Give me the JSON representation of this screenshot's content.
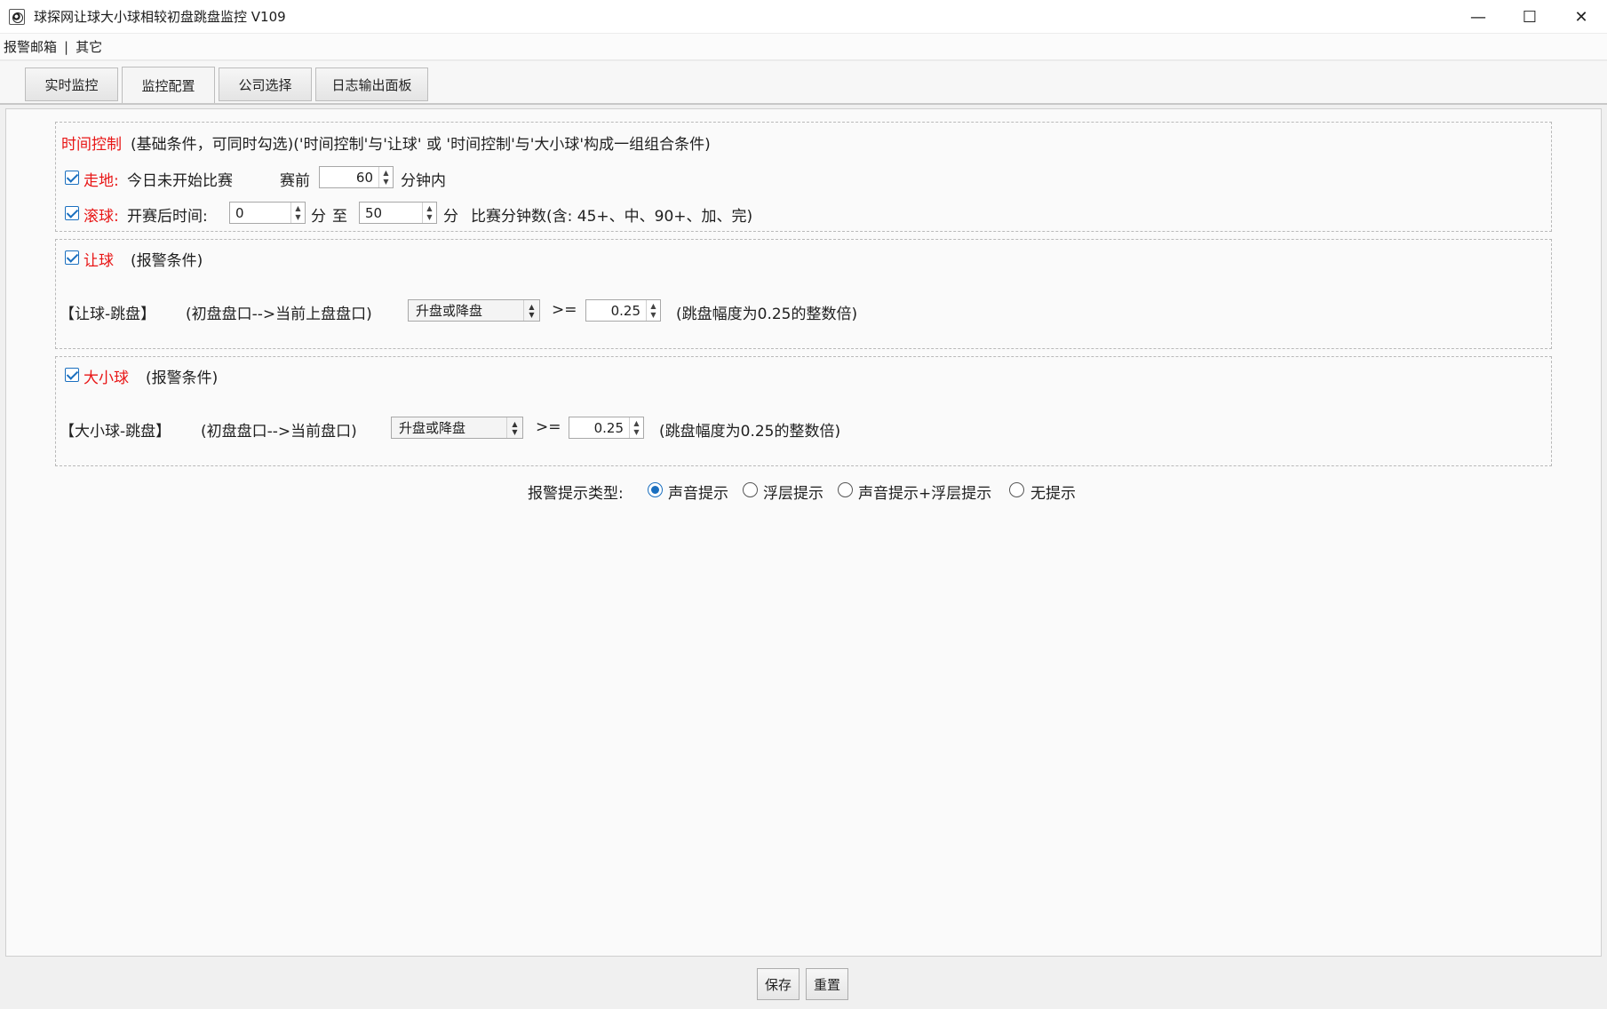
{
  "window": {
    "title": "球探网让球大小球相较初盘跳盘监控 V109",
    "app_icon": "soccer-ball-icon",
    "controls": {
      "minimize": "—",
      "maximize": "☐",
      "close": "✕"
    }
  },
  "menu": {
    "items": [
      "报警邮箱",
      "其它"
    ],
    "separator": "|"
  },
  "tabs": [
    "实时监控",
    "监控配置",
    "公司选择",
    "日志输出面板"
  ],
  "active_tab": "监控配置",
  "time_group": {
    "title": "时间控制",
    "desc": "(基础条件，可同时勾选)('时间控制'与'让球' 或 '时间控制'与'大小球'构成一组组合条件)",
    "zoudi": {
      "checked": true,
      "label": "走地:",
      "desc": "今日未开始比赛",
      "pre_label": "赛前",
      "minutes": "60",
      "suffix": "分钟内"
    },
    "gunqiu": {
      "checked": true,
      "label": "滚球:",
      "desc": "开赛后时间:",
      "from": "0",
      "unit1": "分",
      "to_label": "至",
      "to": "50",
      "unit2": "分",
      "note": "比赛分钟数(含: 45+、中、90+、加、完)"
    }
  },
  "rangqiu_group": {
    "checked": true,
    "title": "让球",
    "desc": "(报警条件)",
    "row_label": "【让球-跳盘】",
    "row_desc": "(初盘盘口-->当前上盘盘口)",
    "direction": "升盘或降盘",
    "op": ">=",
    "value": "0.25",
    "note": "(跳盘幅度为0.25的整数倍)"
  },
  "daxiao_group": {
    "checked": true,
    "title": "大小球",
    "desc": "(报警条件)",
    "row_label": "【大小球-跳盘】",
    "row_desc": "(初盘盘口-->当前盘口)",
    "direction": "升盘或降盘",
    "op": ">=",
    "value": "0.25",
    "note": "(跳盘幅度为0.25的整数倍)"
  },
  "alert": {
    "label": "报警提示类型:",
    "options": [
      "声音提示",
      "浮层提示",
      "声音提示+浮层提示",
      "无提示"
    ],
    "selected": "声音提示"
  },
  "buttons": {
    "save": "保存",
    "reset": "重置"
  },
  "colors": {
    "accent": "#1a6fbf",
    "highlight": "#e81515"
  }
}
